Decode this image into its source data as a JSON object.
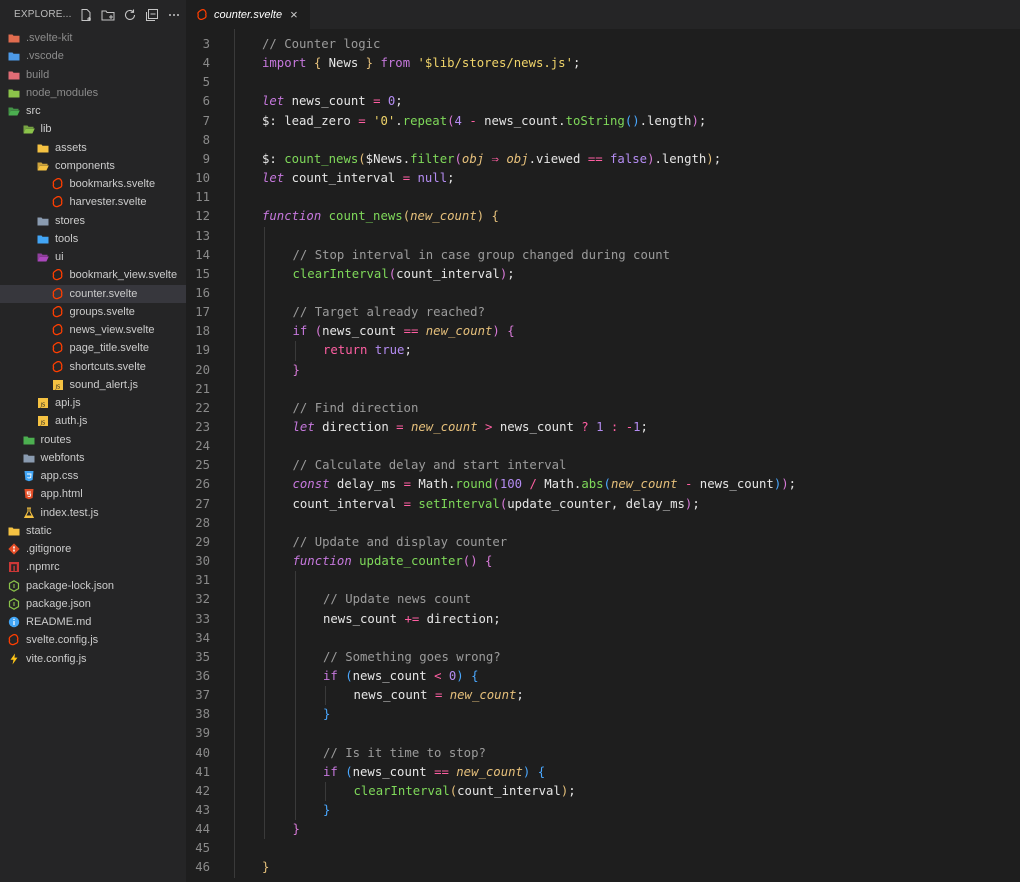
{
  "explorer": {
    "title": "EXPLORE...",
    "items": [
      {
        "label": ".svelte-kit",
        "depth": 0,
        "icon": "folder-icon",
        "color": "#e06c4f",
        "dim": true
      },
      {
        "label": ".vscode",
        "depth": 0,
        "icon": "folder-icon",
        "color": "#4d9ae8",
        "dim": true
      },
      {
        "label": "build",
        "depth": 0,
        "icon": "folder-icon",
        "color": "#e06c75",
        "dim": true
      },
      {
        "label": "node_modules",
        "depth": 0,
        "icon": "folder-icon",
        "color": "#8bc34a",
        "dim": true
      },
      {
        "label": "src",
        "depth": 0,
        "icon": "folder-open-icon",
        "color": "#4caf50",
        "dim": false
      },
      {
        "label": "lib",
        "depth": 1,
        "icon": "folder-open-icon",
        "color": "#8bc34a",
        "dim": false
      },
      {
        "label": "assets",
        "depth": 2,
        "icon": "folder-icon",
        "color": "#f5c242",
        "dim": false
      },
      {
        "label": "components",
        "depth": 2,
        "icon": "folder-open-icon",
        "color": "#f5c242",
        "dim": false
      },
      {
        "label": "bookmarks.svelte",
        "depth": 3,
        "icon": "svelte-icon",
        "color": "#ff3e00",
        "dim": false
      },
      {
        "label": "harvester.svelte",
        "depth": 3,
        "icon": "svelte-icon",
        "color": "#ff3e00",
        "dim": false
      },
      {
        "label": "stores",
        "depth": 2,
        "icon": "folder-icon",
        "color": "#8a9bb0",
        "dim": false
      },
      {
        "label": "tools",
        "depth": 2,
        "icon": "folder-icon",
        "color": "#42a5f5",
        "dim": false
      },
      {
        "label": "ui",
        "depth": 2,
        "icon": "folder-open-icon",
        "color": "#ab47bc",
        "dim": false
      },
      {
        "label": "bookmark_view.svelte",
        "depth": 3,
        "icon": "svelte-icon",
        "color": "#ff3e00",
        "dim": false
      },
      {
        "label": "counter.svelte",
        "depth": 3,
        "icon": "svelte-icon",
        "color": "#ff3e00",
        "dim": false,
        "selected": true
      },
      {
        "label": "groups.svelte",
        "depth": 3,
        "icon": "svelte-icon",
        "color": "#ff3e00",
        "dim": false
      },
      {
        "label": "news_view.svelte",
        "depth": 3,
        "icon": "svelte-icon",
        "color": "#ff3e00",
        "dim": false
      },
      {
        "label": "page_title.svelte",
        "depth": 3,
        "icon": "svelte-icon",
        "color": "#ff3e00",
        "dim": false
      },
      {
        "label": "shortcuts.svelte",
        "depth": 3,
        "icon": "svelte-icon",
        "color": "#ff3e00",
        "dim": false
      },
      {
        "label": "sound_alert.js",
        "depth": 3,
        "icon": "js-icon",
        "color": "#f5c242",
        "dim": false
      },
      {
        "label": "api.js",
        "depth": 2,
        "icon": "js-icon",
        "color": "#f5c242",
        "dim": false
      },
      {
        "label": "auth.js",
        "depth": 2,
        "icon": "js-icon",
        "color": "#f5c242",
        "dim": false
      },
      {
        "label": "routes",
        "depth": 1,
        "icon": "folder-icon",
        "color": "#4caf50",
        "dim": false
      },
      {
        "label": "webfonts",
        "depth": 1,
        "icon": "folder-icon",
        "color": "#8a9bb0",
        "dim": false
      },
      {
        "label": "app.css",
        "depth": 1,
        "icon": "css-icon",
        "color": "#42a5f5",
        "dim": false
      },
      {
        "label": "app.html",
        "depth": 1,
        "icon": "html-icon",
        "color": "#e44d26",
        "dim": false
      },
      {
        "label": "index.test.js",
        "depth": 1,
        "icon": "test-icon",
        "color": "#f5c242",
        "dim": false
      },
      {
        "label": "static",
        "depth": 0,
        "icon": "folder-icon",
        "color": "#f5c242",
        "dim": false
      },
      {
        "label": ".gitignore",
        "depth": 0,
        "icon": "git-icon",
        "color": "#e44d26",
        "dim": false
      },
      {
        "label": ".npmrc",
        "depth": 0,
        "icon": "npm-icon",
        "color": "#cb3837",
        "dim": false
      },
      {
        "label": "package-lock.json",
        "depth": 0,
        "icon": "nodejs-icon",
        "color": "#8bc34a",
        "dim": false
      },
      {
        "label": "package.json",
        "depth": 0,
        "icon": "nodejs-icon",
        "color": "#8bc34a",
        "dim": false
      },
      {
        "label": "README.md",
        "depth": 0,
        "icon": "info-icon",
        "color": "#42a5f5",
        "dim": false
      },
      {
        "label": "svelte.config.js",
        "depth": 0,
        "icon": "svelte-icon",
        "color": "#ff3e00",
        "dim": false
      },
      {
        "label": "vite.config.js",
        "depth": 0,
        "icon": "vite-icon",
        "color": "#ffc517",
        "dim": false
      }
    ]
  },
  "tab": {
    "label": "counter.svelte",
    "close": "×"
  },
  "editor": {
    "lines": [
      {
        "n": "3",
        "indent": 1,
        "tokens": [
          [
            "cm",
            "// Counter logic"
          ]
        ]
      },
      {
        "n": "4",
        "indent": 1,
        "tokens": [
          [
            "kw",
            "import "
          ],
          [
            "b1",
            "{ "
          ],
          [
            "va",
            "News "
          ],
          [
            "b1",
            "} "
          ],
          [
            "kw",
            "from "
          ],
          [
            "str",
            "'$lib/stores/news.js'"
          ],
          [
            "va",
            ";"
          ]
        ]
      },
      {
        "n": "5",
        "indent": 1,
        "tokens": []
      },
      {
        "n": "6",
        "indent": 1,
        "tokens": [
          [
            "kwi",
            "let "
          ],
          [
            "va",
            "news_count "
          ],
          [
            "op",
            "= "
          ],
          [
            "num",
            "0"
          ],
          [
            "va",
            ";"
          ]
        ]
      },
      {
        "n": "7",
        "indent": 1,
        "tokens": [
          [
            "va",
            "$: lead_zero "
          ],
          [
            "op",
            "= "
          ],
          [
            "str",
            "'0'"
          ],
          [
            "va",
            "."
          ],
          [
            "fn",
            "repeat"
          ],
          [
            "b2",
            "("
          ],
          [
            "num",
            "4 "
          ],
          [
            "op",
            "- "
          ],
          [
            "va",
            "news_count."
          ],
          [
            "fn",
            "toString"
          ],
          [
            "b3",
            "()"
          ],
          [
            "va",
            ".length"
          ],
          [
            "b2",
            ")"
          ],
          [
            "va",
            ";"
          ]
        ]
      },
      {
        "n": "8",
        "indent": 1,
        "tokens": []
      },
      {
        "n": "9",
        "indent": 1,
        "tokens": [
          [
            "va",
            "$: "
          ],
          [
            "fn",
            "count_news"
          ],
          [
            "b1",
            "("
          ],
          [
            "va",
            "$News."
          ],
          [
            "fn",
            "filter"
          ],
          [
            "b2",
            "("
          ],
          [
            "par",
            "obj "
          ],
          [
            "op",
            "⇒ "
          ],
          [
            "par",
            "obj"
          ],
          [
            "va",
            ".viewed "
          ],
          [
            "op",
            "== "
          ],
          [
            "bool",
            "false"
          ],
          [
            "b2",
            ")"
          ],
          [
            "va",
            ".length"
          ],
          [
            "b1",
            ")"
          ],
          [
            "va",
            ";"
          ]
        ]
      },
      {
        "n": "10",
        "indent": 1,
        "tokens": [
          [
            "kwi",
            "let "
          ],
          [
            "va",
            "count_interval "
          ],
          [
            "op",
            "= "
          ],
          [
            "bool",
            "null"
          ],
          [
            "va",
            ";"
          ]
        ]
      },
      {
        "n": "11",
        "indent": 1,
        "tokens": []
      },
      {
        "n": "12",
        "indent": 1,
        "tokens": [
          [
            "kwi",
            "function "
          ],
          [
            "fn",
            "count_news"
          ],
          [
            "b1",
            "("
          ],
          [
            "par",
            "new_count"
          ],
          [
            "b1",
            ") "
          ],
          [
            "b1",
            "{"
          ]
        ]
      },
      {
        "n": "13",
        "indent": 2,
        "tokens": []
      },
      {
        "n": "14",
        "indent": 2,
        "tokens": [
          [
            "cm",
            "// Stop interval in case group changed during count"
          ]
        ]
      },
      {
        "n": "15",
        "indent": 2,
        "tokens": [
          [
            "fn",
            "clearInterval"
          ],
          [
            "b2",
            "("
          ],
          [
            "va",
            "count_interval"
          ],
          [
            "b2",
            ")"
          ],
          [
            "va",
            ";"
          ]
        ]
      },
      {
        "n": "16",
        "indent": 2,
        "tokens": []
      },
      {
        "n": "17",
        "indent": 2,
        "tokens": [
          [
            "cm",
            "// Target already reached?"
          ]
        ]
      },
      {
        "n": "18",
        "indent": 2,
        "tokens": [
          [
            "kw",
            "if "
          ],
          [
            "b2",
            "("
          ],
          [
            "va",
            "news_count "
          ],
          [
            "op",
            "== "
          ],
          [
            "par",
            "new_count"
          ],
          [
            "b2",
            ") {"
          ]
        ]
      },
      {
        "n": "19",
        "indent": 3,
        "tokens": [
          [
            "ret",
            "return "
          ],
          [
            "bool",
            "true"
          ],
          [
            "va",
            ";"
          ]
        ]
      },
      {
        "n": "20",
        "indent": 2,
        "tokens": [
          [
            "b2",
            "}"
          ]
        ]
      },
      {
        "n": "21",
        "indent": 2,
        "tokens": []
      },
      {
        "n": "22",
        "indent": 2,
        "tokens": [
          [
            "cm",
            "// Find direction"
          ]
        ]
      },
      {
        "n": "23",
        "indent": 2,
        "tokens": [
          [
            "kwi",
            "let "
          ],
          [
            "va",
            "direction "
          ],
          [
            "op",
            "= "
          ],
          [
            "par",
            "new_count "
          ],
          [
            "op",
            "> "
          ],
          [
            "va",
            "news_count "
          ],
          [
            "op",
            "? "
          ],
          [
            "num",
            "1 "
          ],
          [
            "op",
            ": "
          ],
          [
            "op",
            "-"
          ],
          [
            "num",
            "1"
          ],
          [
            "va",
            ";"
          ]
        ]
      },
      {
        "n": "24",
        "indent": 2,
        "tokens": []
      },
      {
        "n": "25",
        "indent": 2,
        "tokens": [
          [
            "cm",
            "// Calculate delay and start interval"
          ]
        ]
      },
      {
        "n": "26",
        "indent": 2,
        "tokens": [
          [
            "kwi",
            "const "
          ],
          [
            "va",
            "delay_ms "
          ],
          [
            "op",
            "= "
          ],
          [
            "va",
            "Math."
          ],
          [
            "fn",
            "round"
          ],
          [
            "b2",
            "("
          ],
          [
            "num",
            "100 "
          ],
          [
            "op",
            "/ "
          ],
          [
            "va",
            "Math."
          ],
          [
            "fn",
            "abs"
          ],
          [
            "b3",
            "("
          ],
          [
            "par",
            "new_count "
          ],
          [
            "op",
            "- "
          ],
          [
            "va",
            "news_count"
          ],
          [
            "b3",
            ")"
          ],
          [
            "b2",
            ")"
          ],
          [
            "va",
            ";"
          ]
        ]
      },
      {
        "n": "27",
        "indent": 2,
        "tokens": [
          [
            "va",
            "count_interval "
          ],
          [
            "op",
            "= "
          ],
          [
            "fn",
            "setInterval"
          ],
          [
            "b2",
            "("
          ],
          [
            "va",
            "update_counter, delay_ms"
          ],
          [
            "b2",
            ")"
          ],
          [
            "va",
            ";"
          ]
        ]
      },
      {
        "n": "28",
        "indent": 2,
        "tokens": []
      },
      {
        "n": "29",
        "indent": 2,
        "tokens": [
          [
            "cm",
            "// Update and display counter"
          ]
        ]
      },
      {
        "n": "30",
        "indent": 2,
        "tokens": [
          [
            "kwi",
            "function "
          ],
          [
            "fn",
            "update_counter"
          ],
          [
            "b2",
            "() {"
          ]
        ]
      },
      {
        "n": "31",
        "indent": 3,
        "tokens": []
      },
      {
        "n": "32",
        "indent": 3,
        "tokens": [
          [
            "cm",
            "// Update news count"
          ]
        ]
      },
      {
        "n": "33",
        "indent": 3,
        "tokens": [
          [
            "va",
            "news_count "
          ],
          [
            "op",
            "+= "
          ],
          [
            "va",
            "direction;"
          ]
        ]
      },
      {
        "n": "34",
        "indent": 3,
        "tokens": []
      },
      {
        "n": "35",
        "indent": 3,
        "tokens": [
          [
            "cm",
            "// Something goes wrong?"
          ]
        ]
      },
      {
        "n": "36",
        "indent": 3,
        "tokens": [
          [
            "kw",
            "if "
          ],
          [
            "b3",
            "("
          ],
          [
            "va",
            "news_count "
          ],
          [
            "op",
            "< "
          ],
          [
            "num",
            "0"
          ],
          [
            "b3",
            ") {"
          ]
        ]
      },
      {
        "n": "37",
        "indent": 4,
        "tokens": [
          [
            "va",
            "news_count "
          ],
          [
            "op",
            "= "
          ],
          [
            "par",
            "new_count"
          ],
          [
            "va",
            ";"
          ]
        ]
      },
      {
        "n": "38",
        "indent": 3,
        "tokens": [
          [
            "b3",
            "}"
          ]
        ]
      },
      {
        "n": "39",
        "indent": 3,
        "tokens": []
      },
      {
        "n": "40",
        "indent": 3,
        "tokens": [
          [
            "cm",
            "// Is it time to stop?"
          ]
        ]
      },
      {
        "n": "41",
        "indent": 3,
        "tokens": [
          [
            "kw",
            "if "
          ],
          [
            "b3",
            "("
          ],
          [
            "va",
            "news_count "
          ],
          [
            "op",
            "== "
          ],
          [
            "par",
            "new_count"
          ],
          [
            "b3",
            ") {"
          ]
        ]
      },
      {
        "n": "42",
        "indent": 4,
        "tokens": [
          [
            "fn",
            "clearInterval"
          ],
          [
            "b1",
            "("
          ],
          [
            "va",
            "count_interval"
          ],
          [
            "b1",
            ")"
          ],
          [
            "va",
            ";"
          ]
        ]
      },
      {
        "n": "43",
        "indent": 3,
        "tokens": [
          [
            "b3",
            "}"
          ]
        ]
      },
      {
        "n": "44",
        "indent": 2,
        "tokens": [
          [
            "b2",
            "}"
          ]
        ]
      },
      {
        "n": "45",
        "indent": 1,
        "tokens": []
      },
      {
        "n": "46",
        "indent": 1,
        "tokens": [
          [
            "b1",
            "}"
          ]
        ]
      }
    ]
  }
}
